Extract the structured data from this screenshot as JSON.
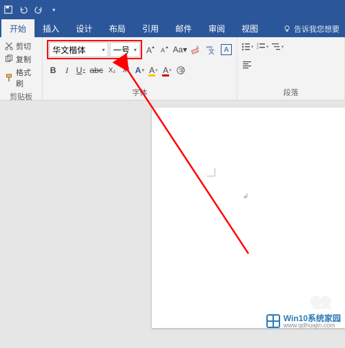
{
  "qat": {
    "undo": "↶",
    "redo": "↷"
  },
  "tabs": [
    {
      "label": "开始",
      "active": true
    },
    {
      "label": "插入"
    },
    {
      "label": "设计"
    },
    {
      "label": "布局"
    },
    {
      "label": "引用"
    },
    {
      "label": "邮件"
    },
    {
      "label": "审阅"
    },
    {
      "label": "视图"
    }
  ],
  "tell_me": "告诉我您想要",
  "clipboard": {
    "cut": "剪切",
    "copy": "复制",
    "brush": "格式刷",
    "label": "剪贴板"
  },
  "font": {
    "name": "华文楷体",
    "size": "一号",
    "change_case": "Aa",
    "label": "字体",
    "btns": {
      "bold": "B",
      "italic": "I",
      "underline": "U",
      "strike": "abc",
      "sub": "X₂",
      "sup": "X²",
      "effect_a": "A",
      "hl_a": "A",
      "color_a": "A",
      "circled": "A",
      "charA": "A"
    }
  },
  "para": {
    "label": "段落"
  },
  "watermark": {
    "title": "Win10系统家园",
    "url": "www.qdhuajin.com"
  }
}
